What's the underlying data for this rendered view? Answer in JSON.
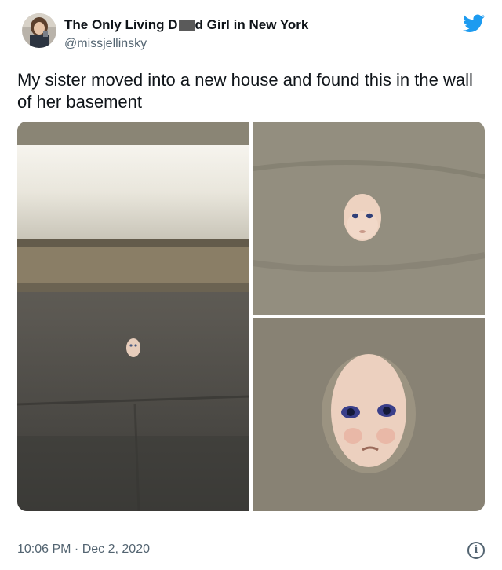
{
  "tweet": {
    "display_name_prefix": "The Only Living D",
    "display_name_suffix": "d Girl in New York",
    "handle": "@missjellinsky",
    "text": "My sister moved into a new house and found this in the wall of her basement",
    "timestamp": "10:06 PM · Dec 2, 2020"
  },
  "icons": {
    "brand": "twitter-bird-icon",
    "info": "info-icon",
    "info_glyph": "i"
  },
  "colors": {
    "brand": "#1d9bf0",
    "secondary_text": "#536471",
    "primary_text": "#0f1419"
  }
}
